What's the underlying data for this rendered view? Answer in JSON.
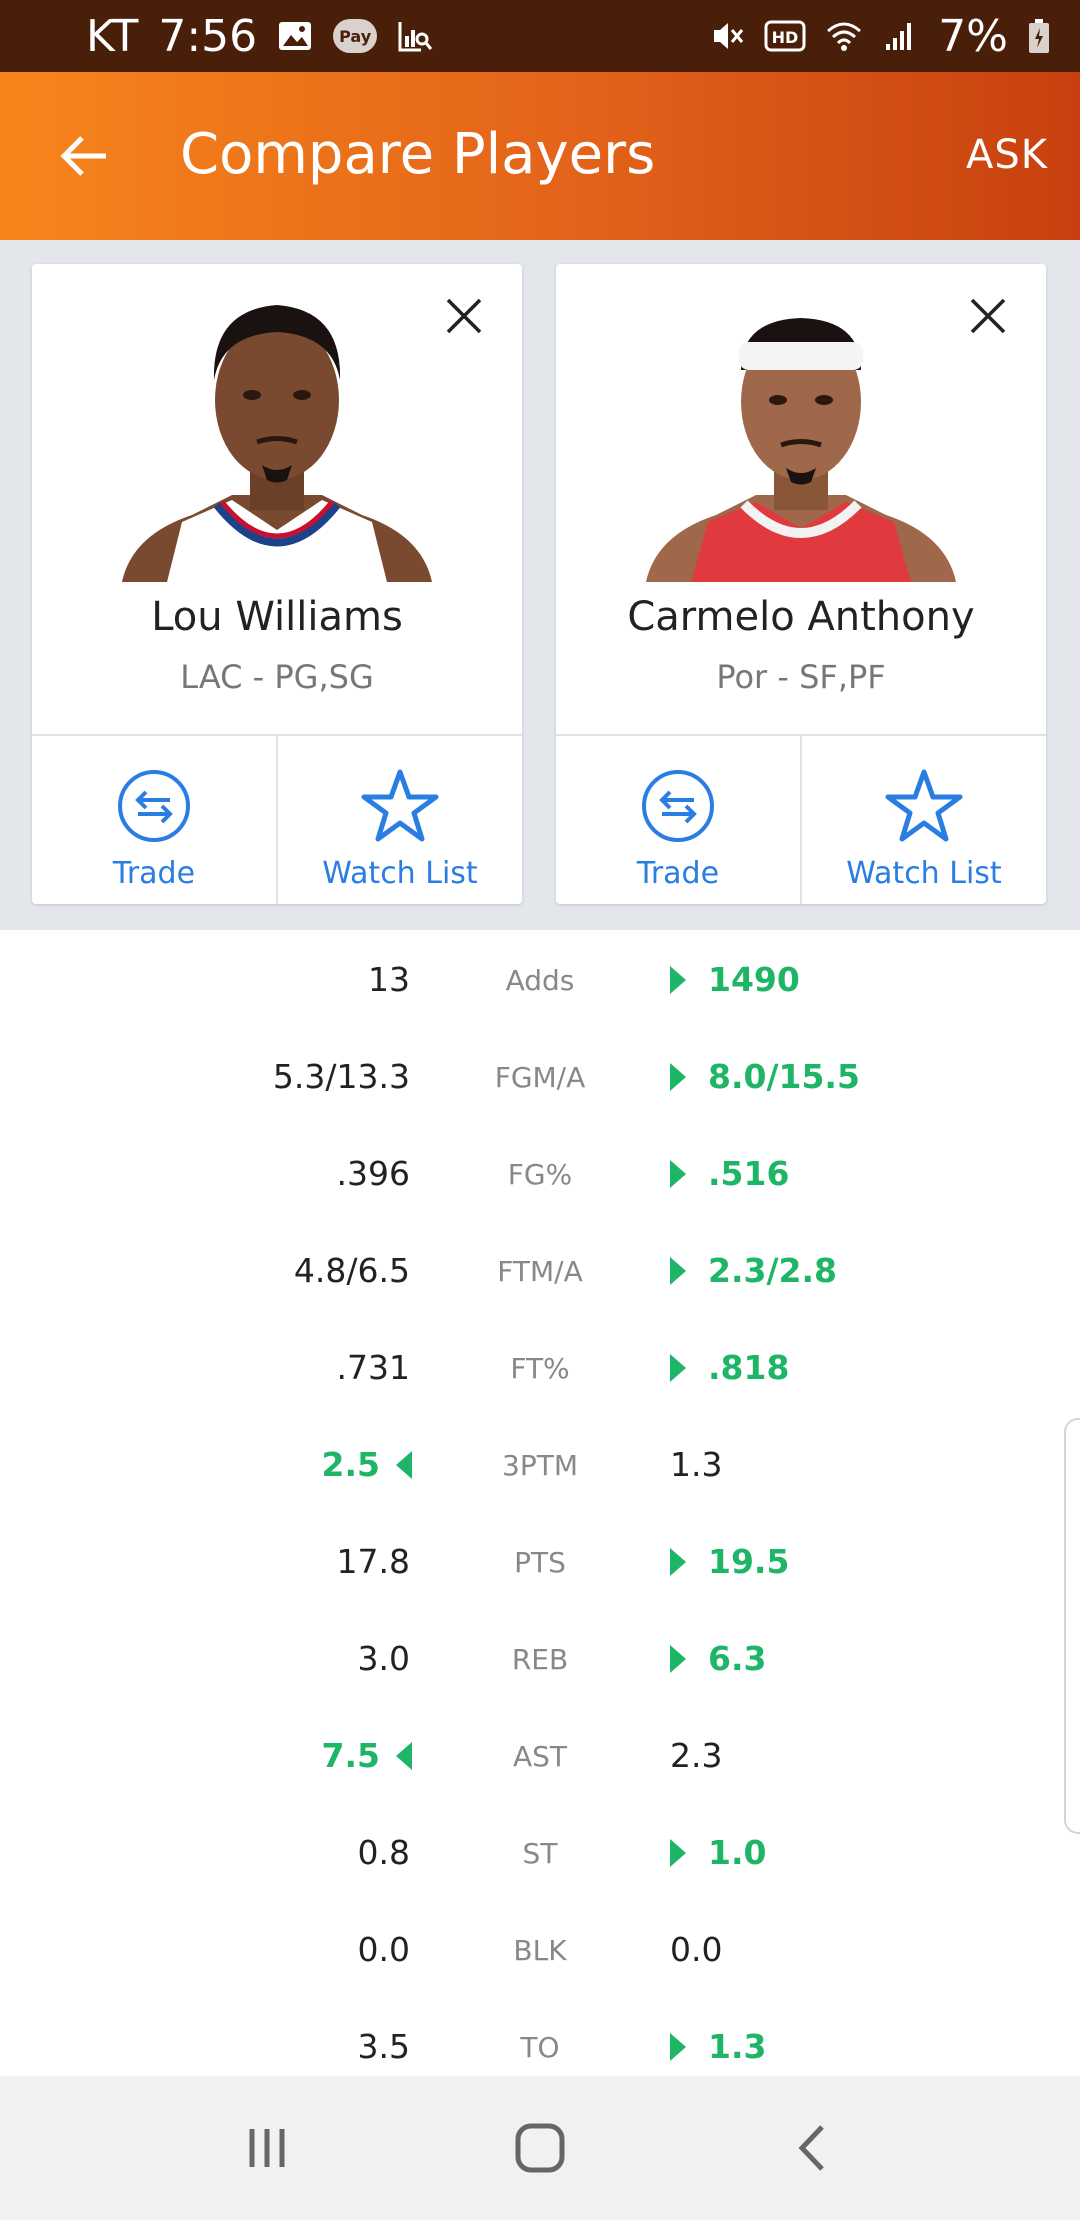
{
  "status_bar": {
    "carrier": "KT",
    "time": "7:56",
    "battery": "7%",
    "icons": [
      "image-icon",
      "pay-icon",
      "chart-search-icon",
      "mute-icon",
      "hd-icon",
      "wifi-icon",
      "signal-icon",
      "battery-icon"
    ],
    "pay_text": "Pay",
    "hd_text": "HD"
  },
  "app_bar": {
    "title": "Compare Players",
    "ask": "ASK",
    "back_icon": "arrow-left-icon"
  },
  "players": [
    {
      "name": "Lou Williams",
      "team_pos": "LAC - PG,SG",
      "trade_label": "Trade",
      "watch_label": "Watch List",
      "jersey_color": "#ffffff"
    },
    {
      "name": "Carmelo Anthony",
      "team_pos": "Por - SF,PF",
      "trade_label": "Trade",
      "watch_label": "Watch List",
      "jersey_color": "#e03a3e"
    }
  ],
  "stats": [
    {
      "label": "Adds",
      "left": "13",
      "right": "1490",
      "winner": "right"
    },
    {
      "label": "FGM/A",
      "left": "5.3/13.3",
      "right": "8.0/15.5",
      "winner": "right"
    },
    {
      "label": "FG%",
      "left": ".396",
      "right": ".516",
      "winner": "right"
    },
    {
      "label": "FTM/A",
      "left": "4.8/6.5",
      "right": "2.3/2.8",
      "winner": "right"
    },
    {
      "label": "FT%",
      "left": ".731",
      "right": ".818",
      "winner": "right"
    },
    {
      "label": "3PTM",
      "left": "2.5",
      "right": "1.3",
      "winner": "left"
    },
    {
      "label": "PTS",
      "left": "17.8",
      "right": "19.5",
      "winner": "right"
    },
    {
      "label": "REB",
      "left": "3.0",
      "right": "6.3",
      "winner": "right"
    },
    {
      "label": "AST",
      "left": "7.5",
      "right": "2.3",
      "winner": "left"
    },
    {
      "label": "ST",
      "left": "0.8",
      "right": "1.0",
      "winner": "right"
    },
    {
      "label": "BLK",
      "left": "0.0",
      "right": "0.0",
      "winner": "none"
    },
    {
      "label": "TO",
      "left": "3.5",
      "right": "1.3",
      "winner": "right"
    }
  ],
  "colors": {
    "accent": "#f7851b",
    "link": "#2a7de1",
    "win": "#1fb566"
  },
  "nav": {
    "icons": [
      "recent-apps-icon",
      "home-icon",
      "back-icon"
    ]
  }
}
